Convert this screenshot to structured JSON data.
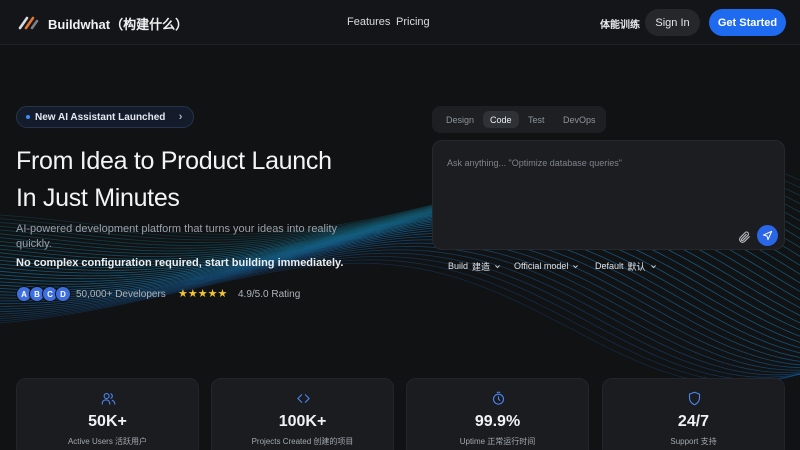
{
  "header": {
    "brand": "Buildwhat（构建什么）",
    "nav": [
      "Features",
      "Pricing"
    ],
    "training": "体能训练",
    "signin_label": "Sign In",
    "get_started_label": "Get Started"
  },
  "hero": {
    "badge": "New AI Assistant Launched",
    "title_line1": "From Idea to Product Launch",
    "title_line2": "In Just Minutes",
    "subtitle": "AI-powered development platform that turns your ideas into reality quickly.",
    "subtitle2": "No complex configuration required, start building immediately.",
    "avatars": [
      "A",
      "B",
      "C",
      "D"
    ],
    "developers": "50,000+ Developers",
    "stars": "★★★★★",
    "rating_value": 4.9,
    "rating": "4.9/5.0 Rating"
  },
  "panel": {
    "tabs": [
      "Design",
      "Code",
      "Test",
      "DevOps"
    ],
    "active_tab": "Code",
    "placeholder": "Ask anything... \"Optimize database queries\"",
    "dropdowns": [
      {
        "label": "Build",
        "cn": "建造"
      },
      {
        "label": "Official model",
        "cn": ""
      },
      {
        "label": "Default",
        "cn": "默认"
      }
    ]
  },
  "stats": [
    {
      "icon": "users-icon",
      "value": "50K+",
      "label": "Active Users  活跃用户"
    },
    {
      "icon": "code-icon",
      "value": "100K+",
      "label": "Projects Created  创建的项目"
    },
    {
      "icon": "stopwatch-icon",
      "value": "99.9%",
      "label": "Uptime  正常运行时间"
    },
    {
      "icon": "shield-icon",
      "value": "24/7",
      "label": "Support  支持"
    }
  ],
  "colors": {
    "background": "#111214",
    "accent": "#1f6bf0",
    "star": "#f2c436",
    "icon_blue": "#4a86f0"
  }
}
